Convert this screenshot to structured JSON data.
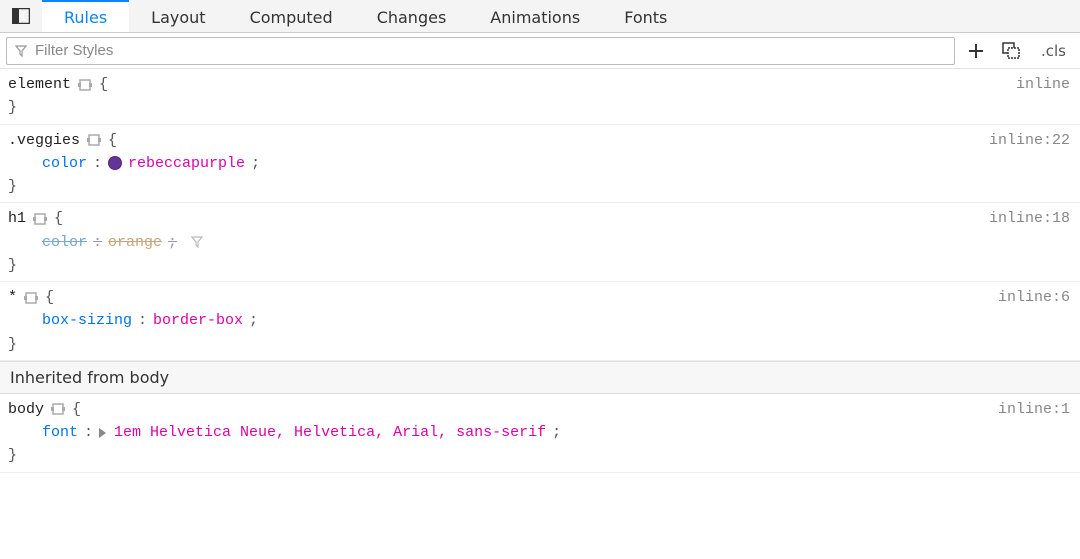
{
  "tabs": {
    "items": [
      "Rules",
      "Layout",
      "Computed",
      "Changes",
      "Animations",
      "Fonts"
    ],
    "active_index": 0
  },
  "filter": {
    "placeholder": "Filter Styles",
    "value": ""
  },
  "toolbar": {
    "cls_label": ".cls"
  },
  "inherited_label": "Inherited from body",
  "rules": [
    {
      "selector": "element",
      "source": "inline",
      "declarations": []
    },
    {
      "selector": ".veggies",
      "source": "inline:22",
      "declarations": [
        {
          "property": "color",
          "value": "rebeccapurple",
          "swatch": "#663399",
          "overridden": false
        }
      ]
    },
    {
      "selector": "h1",
      "source": "inline:18",
      "declarations": [
        {
          "property": "color",
          "value": "orange",
          "overridden": true,
          "filter_icon": true
        }
      ]
    },
    {
      "selector": "*",
      "source": "inline:6",
      "declarations": [
        {
          "property": "box-sizing",
          "value": "border-box",
          "overridden": false
        }
      ]
    }
  ],
  "inherited_rules": [
    {
      "selector": "body",
      "source": "inline:1",
      "declarations": [
        {
          "property": "font",
          "value": "1em Helvetica Neue, Helvetica, Arial, sans-serif",
          "shorthand": true
        }
      ]
    }
  ]
}
